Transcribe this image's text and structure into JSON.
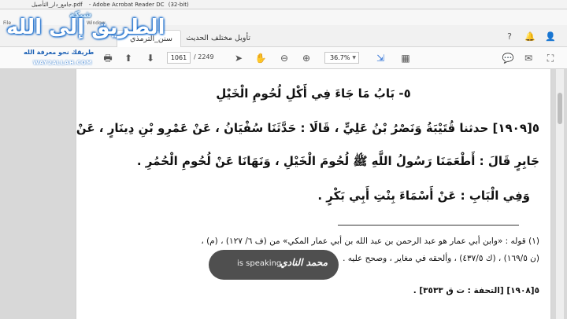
{
  "window": {
    "title_file": "جامع_دار_التأصيل.pdf",
    "title_app": "- Adobe Acrobat Reader DC",
    "title_bits": "(32-bit)",
    "menu_file": "File",
    "menu_window": "Window"
  },
  "tabs": [
    {
      "label": "سنن_الترمذي"
    },
    {
      "label": "تأويل مختلف الحديث"
    }
  ],
  "toolbar": {
    "current_page": "1061",
    "total_pages": "/ 2249",
    "zoom": "36.7%"
  },
  "icons": {
    "help": "?",
    "bell": "🔔",
    "user": "👤",
    "print": "🖶",
    "prev": "⬆",
    "next": "⬇",
    "select": "➤",
    "hand": "✋",
    "zoom_out": "⊖",
    "zoom_in": "⊕",
    "fit": "⇲",
    "comment": "💬",
    "mail": "✉",
    "fullscreen": "⛶",
    "scroll_mode": "▦"
  },
  "document": {
    "chapter_title": "٥- بَابُ مَا جَاءَ فِي أَكْلِ لُحُومِ الْخَيْلِ",
    "line1": "٥[١٩٠٩] حدثنا قُتَيْبَةُ وَنَصْرُ بْنُ عَلِيٍّ ، قَالَا : حَدَّثَنَا سُفْيَانُ ، عَنْ عَمْرِو بْنِ دِينَارٍ ، عَنْ",
    "line2": "جَابِرٍ قَالَ : أَطْعَمَنَا رَسُولُ اللَّهِ ﷺ لُحُومَ الْخَيْلِ ، وَنَهَانَا عَنْ لُحُومِ الْحُمُرِ .",
    "line3": "وَفِي الْبَابِ : عَنْ أَسْمَاءَ بِنْتِ أَبِي بَكْرٍ .",
    "footnote1": "(١) قوله : «وابن أبي عمار هو عبد الرحمن بن عبد الله بن أبي عمار المكي» من (ف ٦/ ١٢٧) ، (م) ،",
    "footnote2": "(ن ١٦٩/٥) ، (ك ٤٣٧/٥) ، وألحقه في                    مغاير ، وصحح عليه .",
    "footnote3": "",
    "footnote4": "٥[١٩٠٨] [التحفة : ت ق ٣٥٣٣] .",
    "footnote5": ""
  },
  "overlay": {
    "speaker": "محمد النادي",
    "status": "is speaking"
  },
  "logo": {
    "shabaka": "شبكة",
    "brand": "الطريق إلى الله",
    "tagline": "طريقك نحو معرفة الله",
    "url": "WAY2ALLAH.COM"
  }
}
